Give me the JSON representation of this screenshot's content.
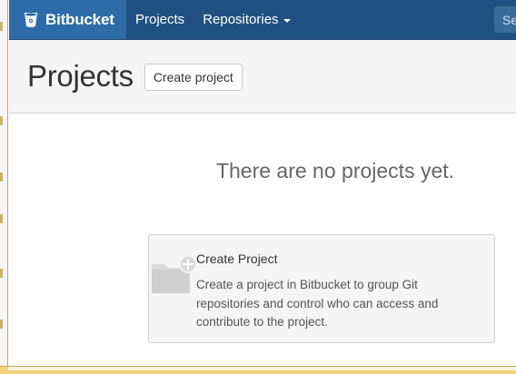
{
  "nav": {
    "brand": "Bitbucket",
    "items": [
      {
        "label": "Projects"
      },
      {
        "label": "Repositories"
      }
    ],
    "search_placeholder": "Se"
  },
  "header": {
    "title": "Projects",
    "create_button": "Create project"
  },
  "empty_state": {
    "message": "There are no projects yet.",
    "card": {
      "title": "Create Project",
      "description": "Create a project in Bitbucket to group Git repositories and control who can access and contribute to the project."
    }
  },
  "colors": {
    "nav_bg": "#205081",
    "brand_bg": "#2d6ca8",
    "header_bg": "#f5f5f5",
    "card_bg": "#f5f5f5"
  }
}
